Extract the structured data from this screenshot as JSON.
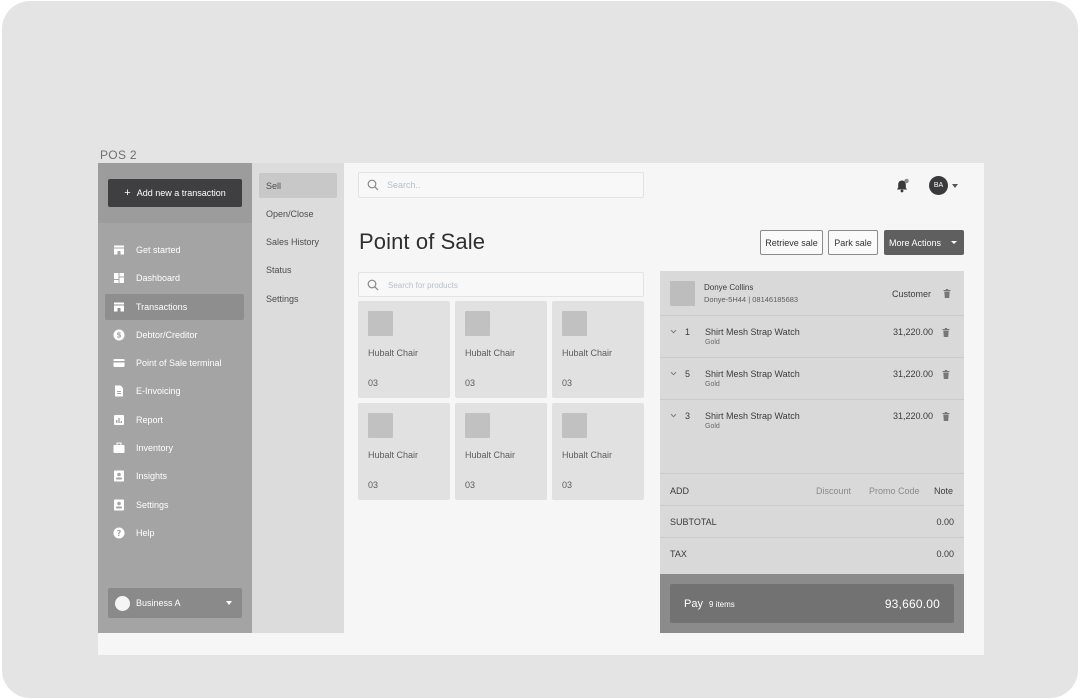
{
  "frame": {
    "label": "POS 2"
  },
  "sidebar": {
    "add_button": "Add new a transaction",
    "items": [
      {
        "label": "Get started",
        "icon": "store-icon"
      },
      {
        "label": "Dashboard",
        "icon": "dashboard-icon"
      },
      {
        "label": "Transactions",
        "icon": "store-icon",
        "active": true
      },
      {
        "label": "Debtor/Creditor",
        "icon": "dollar-icon"
      },
      {
        "label": "Point of Sale terminal",
        "icon": "card-icon"
      },
      {
        "label": "E-Invoicing",
        "icon": "document-icon"
      },
      {
        "label": "Report",
        "icon": "report-icon"
      },
      {
        "label": "Inventory",
        "icon": "briefcase-icon"
      },
      {
        "label": "Insights",
        "icon": "contact-icon"
      },
      {
        "label": "Settings",
        "icon": "contact-icon"
      },
      {
        "label": "Help",
        "icon": "help-icon"
      }
    ],
    "business": "Business A"
  },
  "subnav": {
    "items": [
      {
        "label": "Sell",
        "active": true
      },
      {
        "label": "Open/Close"
      },
      {
        "label": "Sales History"
      },
      {
        "label": "Status"
      },
      {
        "label": "Settings"
      }
    ]
  },
  "header": {
    "search_placeholder": "Search..",
    "avatar_initials": "BA"
  },
  "page": {
    "title": "Point of Sale",
    "retrieve_sale": "Retrieve sale",
    "park_sale": "Park sale",
    "more_actions": "More Actions",
    "product_search_placeholder": "Search for products"
  },
  "products": [
    {
      "name": "Hubalt Chair",
      "qty": "03"
    },
    {
      "name": "Hubalt Chair",
      "qty": "03"
    },
    {
      "name": "Hubalt Chair",
      "qty": "03"
    },
    {
      "name": "Hubalt Chair",
      "qty": "03"
    },
    {
      "name": "Hubalt Chair",
      "qty": "03"
    },
    {
      "name": "Hubalt Chair",
      "qty": "03"
    }
  ],
  "cart": {
    "customer": {
      "name": "Donye Collins",
      "details": "Donye-5H44 | 08146185683",
      "type": "Customer"
    },
    "lines": [
      {
        "qty": "1",
        "name": "Shirt Mesh Strap Watch",
        "variant": "Gold",
        "price": "31,220.00"
      },
      {
        "qty": "5",
        "name": "Shirt Mesh Strap Watch",
        "variant": "Gold",
        "price": "31,220.00"
      },
      {
        "qty": "3",
        "name": "Shirt Mesh Strap Watch",
        "variant": "Gold",
        "price": "31,220.00"
      }
    ],
    "add_label": "ADD",
    "discount": "Discount",
    "promo_code": "Promo Code",
    "note": "Note",
    "subtotal_label": "SUBTOTAL",
    "subtotal": "0.00",
    "tax_label": "TAX",
    "tax": "0.00",
    "pay_label": "Pay",
    "pay_items": "9 items",
    "pay_total": "93,660.00"
  }
}
